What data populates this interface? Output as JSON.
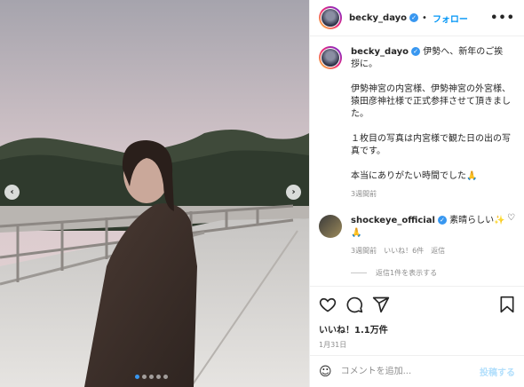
{
  "post": {
    "username": "becky_dayo",
    "follow_label": "フォロー",
    "more_label": "•••"
  },
  "caption": {
    "username": "becky_dayo",
    "line1": "伊勢へ、新年のご挨拶に。",
    "line2": "伊勢神宮の内宮様、伊勢神宮の外宮様、猿田彦神社様で正式参拝させて頂きました。",
    "line3": "１枚目の写真は内宮様で観た日の出の写真です。",
    "line4": "本当にありがたい時間でした🙏",
    "time": "3週間前"
  },
  "comment": {
    "username": "shockeye_official",
    "text": "素晴らしい✨🙏",
    "time": "3週間前",
    "likes": "いいね！6件",
    "reply_label": "返信",
    "view_replies": "返信1件を表示する"
  },
  "stats": {
    "likes": "いいね！1.1万件",
    "date": "1月31日"
  },
  "composer": {
    "placeholder": "コメントを追加...",
    "post_label": "投稿する"
  },
  "carousel": {
    "total": 5,
    "active_index": 0
  },
  "colors": {
    "accent": "#0095f6",
    "dot_active": "#3897f0"
  }
}
